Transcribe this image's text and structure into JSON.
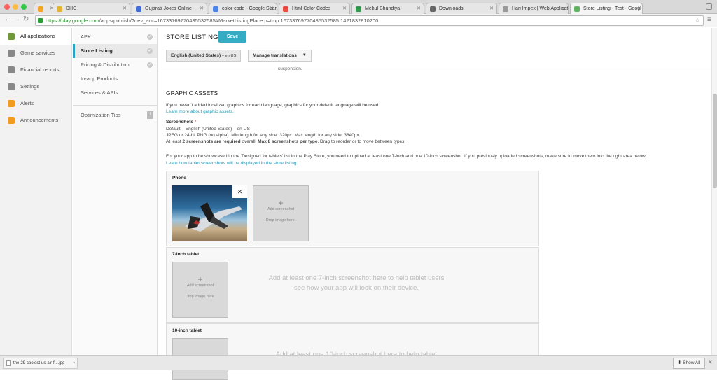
{
  "browser": {
    "tabs": [
      {
        "label": "",
        "color": "#f4a32c"
      },
      {
        "label": "DHC",
        "color": "#e6b23a"
      },
      {
        "label": "Gujarati Jokes Online",
        "color": "#3f6fd1"
      },
      {
        "label": "color code - Google Sear",
        "color": "#4a86e8"
      },
      {
        "label": "Html Color Codes",
        "color": "#e94c3d"
      },
      {
        "label": "Mehul Bhundiya",
        "color": "#2e9b4b"
      },
      {
        "label": "Downloads",
        "color": "#666666"
      },
      {
        "label": "Hari Impex | Web Applicati",
        "color": "#999999"
      },
      {
        "label": "Store Listing - Test - Googl",
        "color": "#5fb35f"
      }
    ],
    "url_host": "https://play.google.com",
    "url_path": "/apps/publish/?dev_acc=16733769770435532585#MarketListingPlace:p=tmp.16733769770435532585.1421832810200"
  },
  "left_nav": [
    {
      "label": "All applications",
      "icon": "android-icon",
      "color": "#6f9a37"
    },
    {
      "label": "Game services",
      "icon": "gamepad-icon",
      "color": "#888888"
    },
    {
      "label": "Financial reports",
      "icon": "reports-icon",
      "color": "#888888"
    },
    {
      "label": "Settings",
      "icon": "gear-icon",
      "color": "#888888"
    },
    {
      "label": "Alerts",
      "icon": "alert-icon",
      "color": "#f39b1f"
    },
    {
      "label": "Announcements",
      "icon": "megaphone-icon",
      "color": "#f39b1f"
    }
  ],
  "sub_nav": {
    "items": [
      {
        "label": "APK"
      },
      {
        "label": "Store Listing"
      },
      {
        "label": "Pricing & Distribution"
      },
      {
        "label": "In-app Products"
      },
      {
        "label": "Services & APIs"
      }
    ],
    "optimization_label": "Optimization Tips",
    "optimization_count": "1"
  },
  "header": {
    "title": "STORE LISTING",
    "save": "Save",
    "language": "English (United States)",
    "language_code": "– en-US",
    "manage": "Manage translations"
  },
  "content": {
    "suspension": "suspension.",
    "section_title": "GRAPHIC ASSETS",
    "intro": "If you haven't added localized graphics for each language, graphics for your default language will be used.",
    "learn_graphic": "Learn more about graphic assets.",
    "screenshots_label": "Screenshots",
    "required_mark": "*",
    "default_line": "Default – English (United States) – en-US",
    "format_line": "JPEG or 24-bit PNG (no alpha). Min length for any side: 320px. Max length for any side: 3840px.",
    "count_pre": "At least ",
    "count_b1": "2 screenshots are required",
    "count_mid": " overall. ",
    "count_b2": "Max 8 screenshots per type",
    "count_post": ". Drag to reorder or to move between types.",
    "tablet_info": "For your app to be showcased in the 'Designed for tablets' list in the Play Store, you need to upload at least one 7-inch and one 10-inch screenshot. If you previously uploaded screenshots, make sure to move them into the right area below.",
    "tablet_link": "Learn how tablet screenshots will be displayed in the store listing.",
    "phone_title": "Phone",
    "remove": "✕",
    "add_screenshot": "Add screenshot",
    "drop_image": "Drop image here.",
    "tablet7_title": "7-inch tablet",
    "tablet7_help": "Add at least one 7-inch screenshot here to help tablet users see how your app will look on their device.",
    "tablet10_title": "10-inch tablet",
    "tablet10_help": "Add at least one 10-inch screenshot here to help tablet"
  },
  "downloads": {
    "file": "the-29-coolest-us-air-f....jpg",
    "show_all": "Show All"
  }
}
